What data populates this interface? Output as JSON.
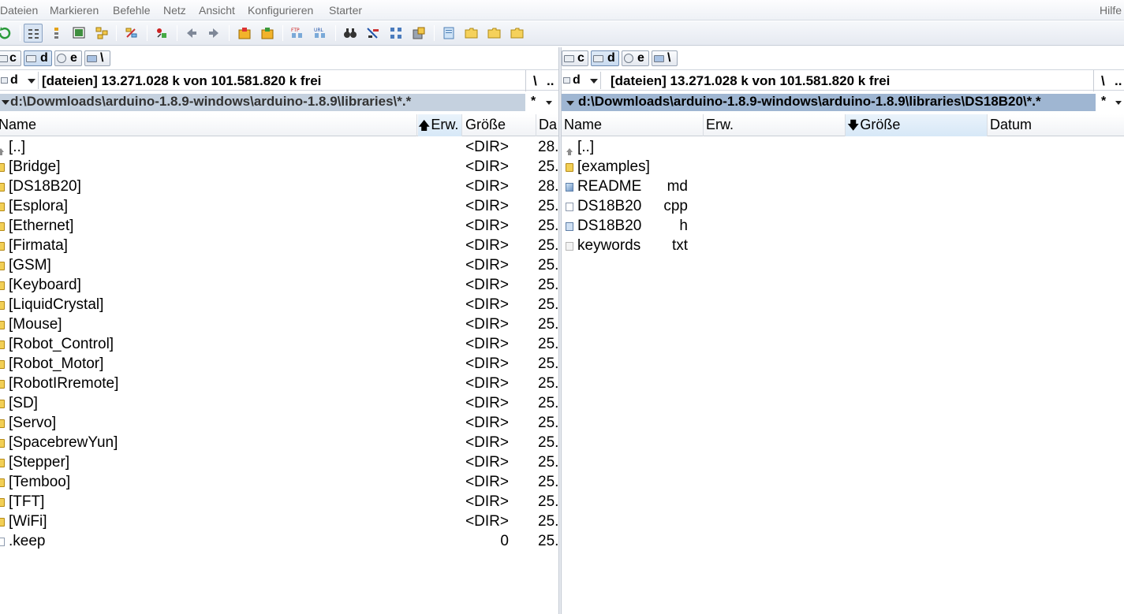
{
  "menu": [
    "Dateien",
    "Markieren",
    "Befehle",
    "Netz",
    "Ansicht",
    "Konfigurieren",
    "Starter"
  ],
  "help": "Hilfe",
  "toolbar": {
    "buttons": [
      "refresh-icon",
      "brief-view-icon",
      "full-view-icon",
      "thumbnail-view-icon",
      "tree-view-icon",
      "invert-selection-icon",
      "compare-icon",
      "back-arrow-icon",
      "forward-arrow-icon",
      "pack-icon",
      "unpack-icon",
      "ftp-icon",
      "url-icon",
      "search-icon",
      "multi-rename-icon",
      "sync-dirs-icon",
      "disk-icon",
      "notepad-icon",
      "folder-icon",
      "folder-icon",
      "folder-icon"
    ]
  },
  "left": {
    "drives": [
      "c",
      "d",
      "e",
      "\\"
    ],
    "active_drive_index": 1,
    "drive": "d",
    "free_info": "[dateien]  13.271.028 k von 101.581.820 k frei",
    "root_buttons": [
      "\\",
      ".."
    ],
    "path": "d:\\Dowmloads\\arduino-1.8.9-windows\\arduino-1.8.9\\libraries\\*.*",
    "filter": "*",
    "columns": {
      "name": "Name",
      "ext": "Erw.",
      "size": "Größe",
      "date": "Da"
    },
    "files": [
      {
        "icon": "up",
        "name": "[..]",
        "ext": "",
        "size": "<DIR>",
        "date": "28."
      },
      {
        "icon": "folder",
        "name": "[Bridge]",
        "ext": "",
        "size": "<DIR>",
        "date": "25."
      },
      {
        "icon": "folder",
        "name": "[DS18B20]",
        "ext": "",
        "size": "<DIR>",
        "date": "28."
      },
      {
        "icon": "folder",
        "name": "[Esplora]",
        "ext": "",
        "size": "<DIR>",
        "date": "25."
      },
      {
        "icon": "folder",
        "name": "[Ethernet]",
        "ext": "",
        "size": "<DIR>",
        "date": "25."
      },
      {
        "icon": "folder",
        "name": "[Firmata]",
        "ext": "",
        "size": "<DIR>",
        "date": "25."
      },
      {
        "icon": "folder",
        "name": "[GSM]",
        "ext": "",
        "size": "<DIR>",
        "date": "25."
      },
      {
        "icon": "folder",
        "name": "[Keyboard]",
        "ext": "",
        "size": "<DIR>",
        "date": "25."
      },
      {
        "icon": "folder",
        "name": "[LiquidCrystal]",
        "ext": "",
        "size": "<DIR>",
        "date": "25."
      },
      {
        "icon": "folder",
        "name": "[Mouse]",
        "ext": "",
        "size": "<DIR>",
        "date": "25."
      },
      {
        "icon": "folder",
        "name": "[Robot_Control]",
        "ext": "",
        "size": "<DIR>",
        "date": "25."
      },
      {
        "icon": "folder",
        "name": "[Robot_Motor]",
        "ext": "",
        "size": "<DIR>",
        "date": "25."
      },
      {
        "icon": "folder",
        "name": "[RobotIRremote]",
        "ext": "",
        "size": "<DIR>",
        "date": "25."
      },
      {
        "icon": "folder",
        "name": "[SD]",
        "ext": "",
        "size": "<DIR>",
        "date": "25."
      },
      {
        "icon": "folder",
        "name": "[Servo]",
        "ext": "",
        "size": "<DIR>",
        "date": "25."
      },
      {
        "icon": "folder",
        "name": "[SpacebrewYun]",
        "ext": "",
        "size": "<DIR>",
        "date": "25."
      },
      {
        "icon": "folder",
        "name": "[Stepper]",
        "ext": "",
        "size": "<DIR>",
        "date": "25."
      },
      {
        "icon": "folder",
        "name": "[Temboo]",
        "ext": "",
        "size": "<DIR>",
        "date": "25."
      },
      {
        "icon": "folder",
        "name": "[TFT]",
        "ext": "",
        "size": "<DIR>",
        "date": "25."
      },
      {
        "icon": "folder",
        "name": "[WiFi]",
        "ext": "",
        "size": "<DIR>",
        "date": "25."
      },
      {
        "icon": "file",
        "name": ".keep",
        "ext": "",
        "size": "0",
        "date": "25."
      }
    ]
  },
  "right": {
    "drives": [
      "c",
      "d",
      "e",
      "\\"
    ],
    "active_drive_index": 1,
    "drive": "d",
    "free_info": "[dateien]  13.271.028 k von 101.581.820 k frei",
    "root_buttons": [
      "\\",
      ".."
    ],
    "path": "d:\\Dowmloads\\arduino-1.8.9-windows\\arduino-1.8.9\\libraries\\DS18B20\\*.*",
    "filter": "*",
    "columns": {
      "name": "Name",
      "ext": "Erw.",
      "size": "Größe",
      "date": "Datum"
    },
    "files": [
      {
        "icon": "up",
        "name": "[..]",
        "ext": ""
      },
      {
        "icon": "folder",
        "name": "[examples]",
        "ext": ""
      },
      {
        "icon": "md",
        "name": "README",
        "ext": "md"
      },
      {
        "icon": "file",
        "name": "DS18B20",
        "ext": "cpp"
      },
      {
        "icon": "h",
        "name": "DS18B20",
        "ext": "h"
      },
      {
        "icon": "txt",
        "name": "keywords",
        "ext": "txt"
      }
    ]
  }
}
